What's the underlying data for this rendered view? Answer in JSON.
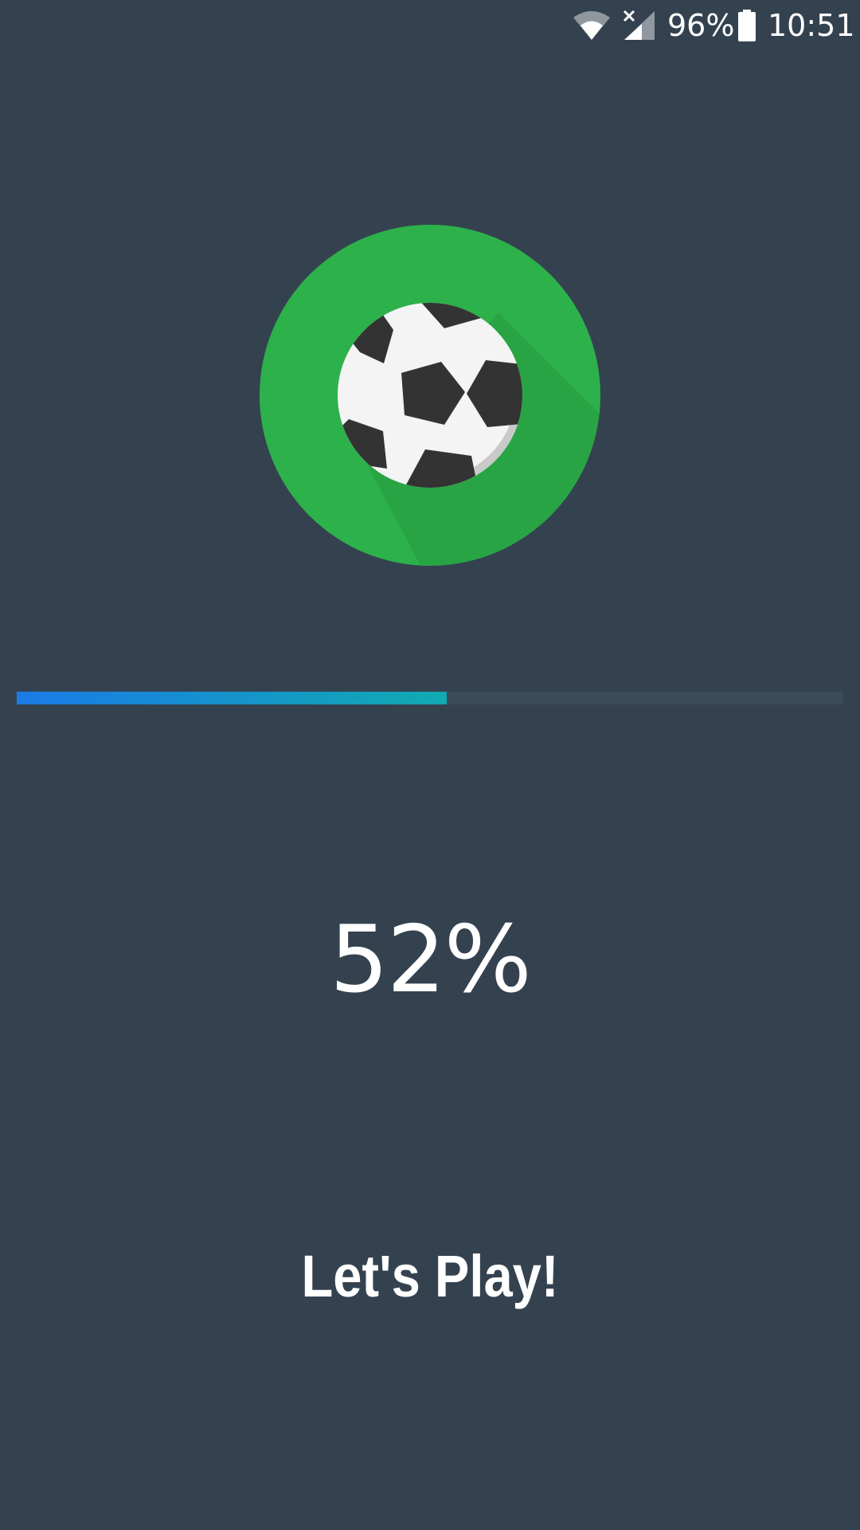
{
  "status_bar": {
    "battery_text": "96%",
    "time": "10:51",
    "icons": [
      "wifi-icon",
      "signal-icon",
      "battery-icon"
    ]
  },
  "logo": {
    "icon": "soccer-ball-icon",
    "circle_color": "#2db14b"
  },
  "progress": {
    "value": 0.52,
    "percent_label": "52%",
    "gradient_start": "#1a7be6",
    "gradient_end": "#11aab0"
  },
  "tagline": "Let's Play!",
  "colors": {
    "background": "#344250"
  }
}
